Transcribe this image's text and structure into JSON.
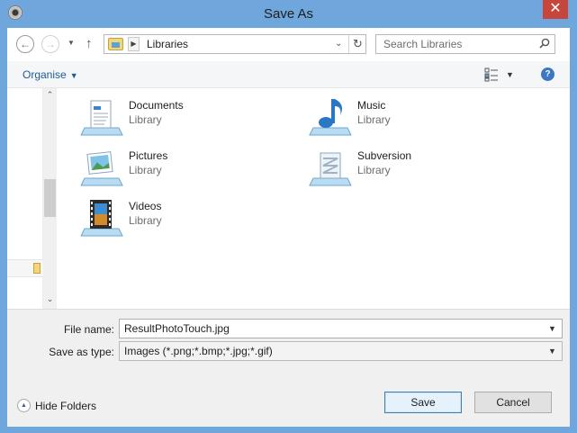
{
  "window": {
    "title": "Save As",
    "close_symbol": "✕",
    "accent_color": "#6fa6dc"
  },
  "nav": {
    "back_icon": "back-arrow-icon",
    "forward_icon": "forward-arrow-icon",
    "up_icon": "up-arrow-icon",
    "breadcrumb": "Libraries",
    "search_placeholder": "Search Libraries"
  },
  "toolbar": {
    "organise_label": "Organise"
  },
  "libraries": [
    {
      "name": "Documents",
      "type": "Library",
      "icon": "documents-library-icon"
    },
    {
      "name": "Music",
      "type": "Library",
      "icon": "music-library-icon"
    },
    {
      "name": "Pictures",
      "type": "Library",
      "icon": "pictures-library-icon"
    },
    {
      "name": "Subversion",
      "type": "Library",
      "icon": "subversion-library-icon"
    },
    {
      "name": "Videos",
      "type": "Library",
      "icon": "videos-library-icon"
    }
  ],
  "form": {
    "file_name_label": "File name:",
    "file_name_value": "ResultPhotoTouch.jpg",
    "save_type_label": "Save as type:",
    "save_type_value": "Images (*.png;*.bmp;*.jpg;*.gif)",
    "hide_folders_label": "Hide Folders",
    "save_label": "Save",
    "cancel_label": "Cancel"
  }
}
